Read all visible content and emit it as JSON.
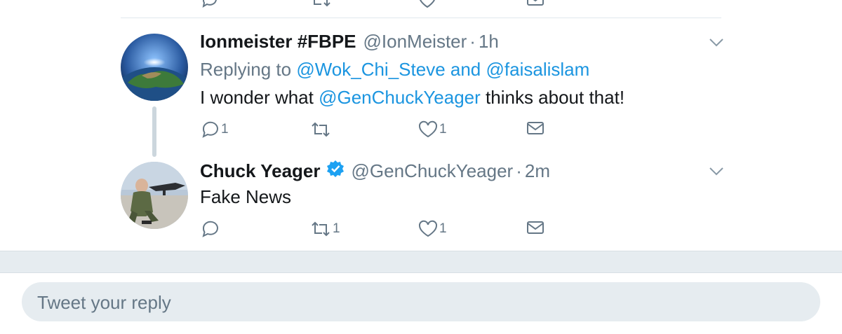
{
  "colors": {
    "link": "#1b95e0",
    "secondary_text": "#657786",
    "primary_text": "#14171a",
    "divider": "#e6ecf0",
    "verified_badge": "#1da1f2"
  },
  "tweets": [
    {
      "display_name": "Ionmeister #FBPE",
      "handle": "@IonMeister",
      "separator": "·",
      "time": "1h",
      "reply_prefix": "Replying to",
      "reply_user_1": "@Wok_Chi_Steve",
      "reply_and": "and",
      "reply_user_2": "@faisalislam",
      "text_before": "I wonder what",
      "mention": "@GenChuckYeager",
      "text_after": "thinks about that!",
      "reply_count": "1",
      "retweet_count": "",
      "like_count": "1",
      "avatar_icon": "earth-avatar"
    },
    {
      "display_name": "Chuck Yeager",
      "verified": true,
      "handle": "@GenChuckYeager",
      "separator": "·",
      "time": "2m",
      "text": "Fake News",
      "reply_count": "",
      "retweet_count": "1",
      "like_count": "1",
      "avatar_icon": "pilot-avatar"
    }
  ],
  "reply_box": {
    "placeholder": "Tweet your reply"
  }
}
